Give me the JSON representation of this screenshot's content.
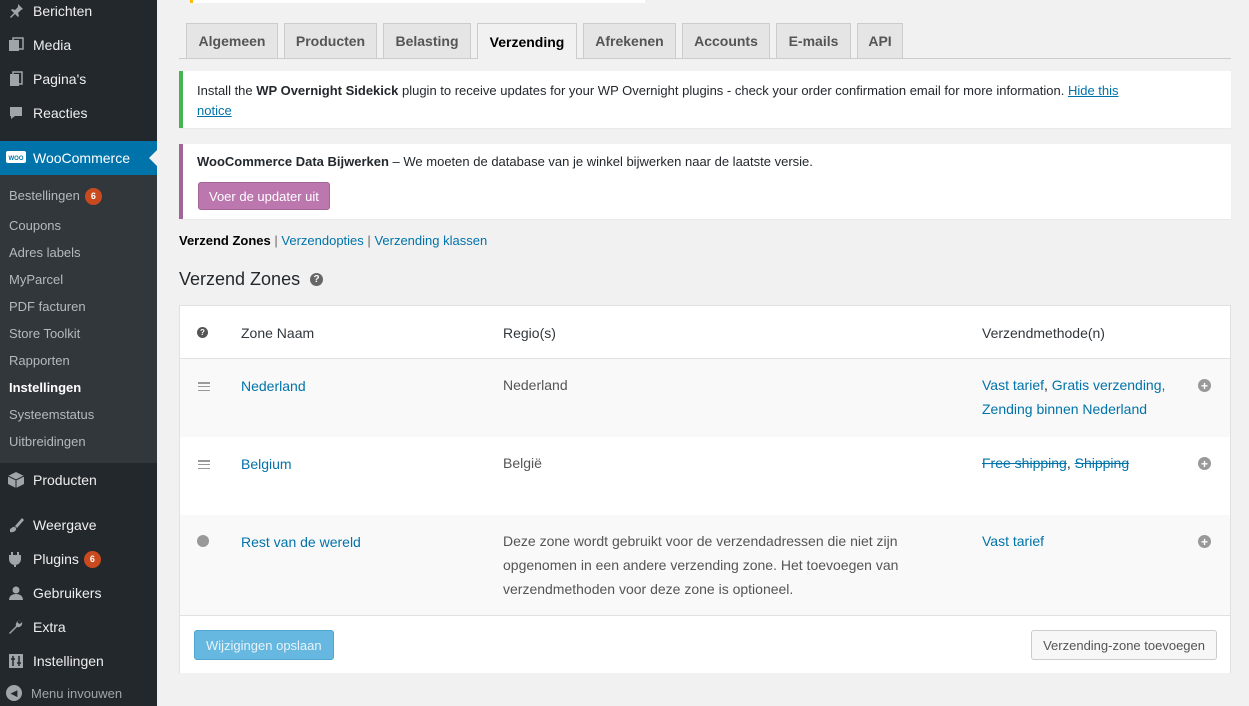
{
  "sidebar": {
    "top_items": [
      {
        "label": "Berichten",
        "icon": "pushpin-icon"
      },
      {
        "label": "Media",
        "icon": "media-icon"
      },
      {
        "label": "Pagina's",
        "icon": "pages-icon"
      },
      {
        "label": "Reacties",
        "icon": "comments-icon"
      }
    ],
    "woocommerce": {
      "label": "WooCommerce",
      "icon": "woo-icon"
    },
    "submenu": [
      {
        "label": "Bestellingen",
        "count": "6"
      },
      {
        "label": "Coupons"
      },
      {
        "label": "Adres labels"
      },
      {
        "label": "MyParcel"
      },
      {
        "label": "PDF facturen"
      },
      {
        "label": "Store Toolkit"
      },
      {
        "label": "Rapporten"
      },
      {
        "label": "Instellingen"
      },
      {
        "label": "Systeemstatus"
      },
      {
        "label": "Uitbreidingen"
      }
    ],
    "bottom_items": [
      {
        "label": "Producten",
        "icon": "box-icon"
      },
      {
        "label": "Weergave",
        "icon": "brush-icon"
      },
      {
        "label": "Plugins",
        "icon": "plug-icon",
        "count": "6"
      },
      {
        "label": "Gebruikers",
        "icon": "users-icon"
      },
      {
        "label": "Extra",
        "icon": "wrench-icon"
      },
      {
        "label": "Instellingen",
        "icon": "settings-icon"
      }
    ],
    "collapse_label": "Menu invouwen"
  },
  "tabs": [
    "Algemeen",
    "Producten",
    "Belasting",
    "Verzending",
    "Afrekenen",
    "Accounts",
    "E-mails",
    "API"
  ],
  "active_tab": "Verzending",
  "notice_sidekick": {
    "text_before": "Install the ",
    "bold": "WP Overnight Sidekick",
    "text_after": " plugin to receive updates for your WP Overnight plugins - check your order confirmation email for more information. ",
    "link_line1": "Hide this",
    "link_line2": "notice"
  },
  "notice_update": {
    "bold": "WooCommerce Data Bijwerken",
    "text": " – We moeten de database van je winkel bijwerken naar de laatste versie.",
    "button": "Voer de updater uit"
  },
  "subnav": {
    "current": "Verzend Zones",
    "links": [
      "Verzendopties",
      "Verzending klassen"
    ],
    "separator": "|"
  },
  "page_title": "Verzend Zones",
  "table": {
    "headers": {
      "zone": "Zone Naam",
      "region": "Regio(s)",
      "methods": "Verzendmethode(n)"
    },
    "rows": [
      {
        "zone": "Nederland",
        "region": "Nederland",
        "methods_line1": [
          "Vast tarief",
          "Gratis verzending,"
        ],
        "methods_line2": "Zending binnen Nederland"
      },
      {
        "zone": "Belgium",
        "region": "België",
        "methods_disabled": [
          "Free shipping",
          "Shipping"
        ]
      },
      {
        "zone": "Rest van de wereld",
        "region_lines": [
          "Deze zone wordt gebruikt voor de verzendadressen die niet zijn",
          "opgenomen in een andere verzending zone. Het toevoegen van",
          "verzendmethoden voor deze zone is optioneel."
        ],
        "methods": "Vast tarief"
      }
    ]
  },
  "buttons": {
    "save": "Wijzigingen opslaan",
    "add_zone": "Verzending-zone toevoegen"
  },
  "colors": {
    "sidebar_bg": "#23282d",
    "active_menu": "#0073aa",
    "link": "#0073aa",
    "woo_purple": "#bb77ae",
    "notice_green": "#46b450",
    "badge": "#ca4a1f"
  }
}
